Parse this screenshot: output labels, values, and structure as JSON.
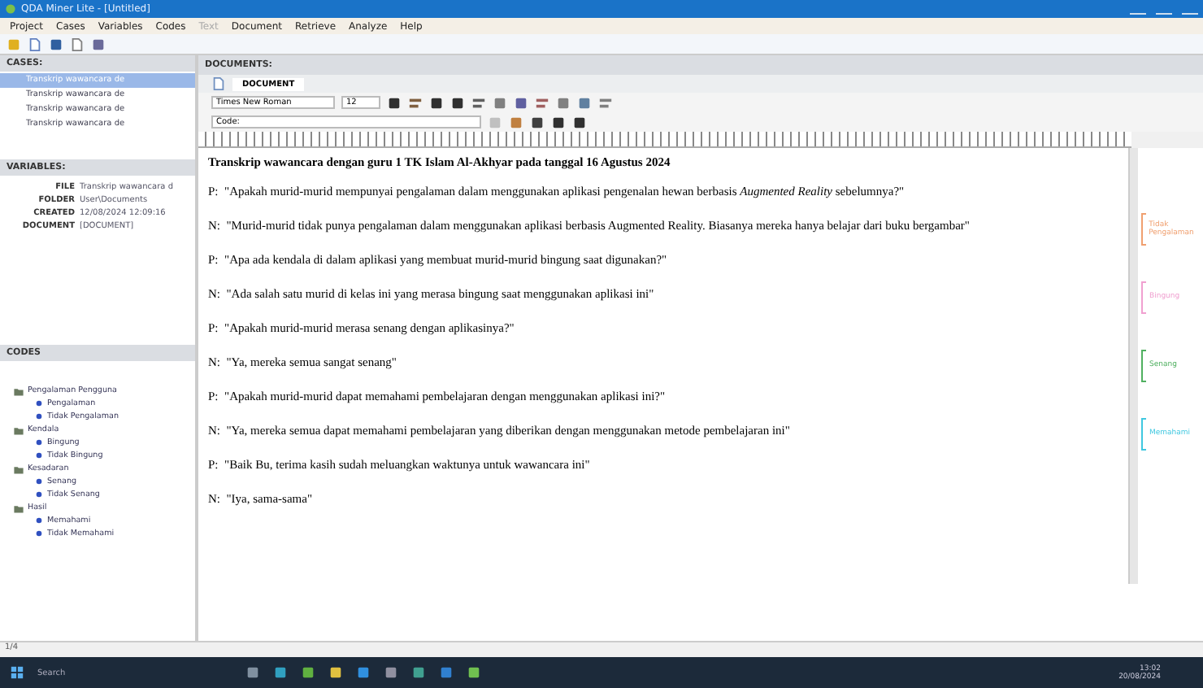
{
  "window": {
    "title": "QDA Miner Lite - [Untitled]"
  },
  "menu": [
    {
      "label": "Project",
      "disabled": false
    },
    {
      "label": "Cases",
      "disabled": false
    },
    {
      "label": "Variables",
      "disabled": false
    },
    {
      "label": "Codes",
      "disabled": false
    },
    {
      "label": "Text",
      "disabled": true
    },
    {
      "label": "Document",
      "disabled": false
    },
    {
      "label": "Retrieve",
      "disabled": false
    },
    {
      "label": "Analyze",
      "disabled": false
    },
    {
      "label": "Help",
      "disabled": false
    }
  ],
  "cases": {
    "header": "CASES:",
    "items": [
      {
        "label": "Transkrip wawancara de",
        "selected": true
      },
      {
        "label": "Transkrip wawancara de",
        "selected": false
      },
      {
        "label": "Transkrip wawancara de",
        "selected": false
      },
      {
        "label": "Transkrip wawancara de",
        "selected": false
      }
    ]
  },
  "variables": {
    "header": "VARIABLES:",
    "rows": [
      {
        "name": "FILE",
        "value": "Transkrip wawancara d"
      },
      {
        "name": "FOLDER",
        "value": "User\\Documents"
      },
      {
        "name": "CREATED",
        "value": "12/08/2024 12:09:16"
      },
      {
        "name": "DOCUMENT",
        "value": "[DOCUMENT]"
      }
    ]
  },
  "codes": {
    "header": "CODES",
    "groups": [
      {
        "label": "Pengalaman Pengguna",
        "children": [
          {
            "label": "Pengalaman"
          },
          {
            "label": "Tidak Pengalaman"
          }
        ]
      },
      {
        "label": "Kendala",
        "children": [
          {
            "label": "Bingung"
          },
          {
            "label": "Tidak Bingung"
          }
        ]
      },
      {
        "label": "Kesadaran",
        "children": [
          {
            "label": "Senang"
          },
          {
            "label": "Tidak Senang"
          }
        ]
      },
      {
        "label": "Hasil",
        "children": [
          {
            "label": "Memahami"
          },
          {
            "label": "Tidak Memahami"
          }
        ]
      }
    ]
  },
  "documents": {
    "header": "DOCUMENTS:",
    "tab": "DOCUMENT",
    "font": "Times New Roman",
    "size": "12",
    "code_label": "Code:"
  },
  "document": {
    "title": "Transkrip wawancara dengan guru 1 TK Islam Al-Akhyar pada tanggal 16 Agustus 2024",
    "paragraphs": [
      {
        "speaker": "P:",
        "text": "\"Apakah murid-murid mempunyai pengalaman dalam menggunakan aplikasi pengenalan hewan berbasis *Augmented Reality* sebelumnya?\""
      },
      {
        "speaker": "N:",
        "text": "\"Murid-murid tidak punya pengalaman dalam menggunakan aplikasi berbasis Augmented Reality. Biasanya mereka hanya belajar dari buku bergambar\"",
        "code": {
          "label": "Tidak Pengalaman",
          "color": "#f0a070"
        }
      },
      {
        "speaker": "P:",
        "text": "\"Apa ada kendala di dalam aplikasi yang membuat murid-murid bingung saat digunakan?\""
      },
      {
        "speaker": "N:",
        "text": "\"Ada salah satu murid di kelas ini yang merasa bingung saat menggunakan aplikasi ini\"",
        "code": {
          "label": "Bingung",
          "color": "#f0a0d0"
        }
      },
      {
        "speaker": "P:",
        "text": "\"Apakah murid-murid merasa senang dengan aplikasinya?\""
      },
      {
        "speaker": "N:",
        "text": "\"Ya, mereka semua sangat senang\"",
        "code": {
          "label": "Senang",
          "color": "#50b060"
        }
      },
      {
        "speaker": "P:",
        "text": "\"Apakah murid-murid dapat memahami pembelajaran dengan menggunakan aplikasi ini?\""
      },
      {
        "speaker": "N:",
        "text": "\"Ya, mereka semua dapat memahami pembelajaran yang diberikan dengan menggunakan metode pembelajaran ini\"",
        "code": {
          "label": "Memahami",
          "color": "#40c8e0"
        }
      },
      {
        "speaker": "P:",
        "text": "\"Baik Bu, terima kasih sudah meluangkan waktunya untuk wawancara ini\""
      },
      {
        "speaker": "N:",
        "text": "\"Iya, sama-sama\""
      }
    ]
  },
  "status_bar": "1/4",
  "taskbar": {
    "search": "Search",
    "time": "13:02",
    "date": "20/08/2024"
  }
}
